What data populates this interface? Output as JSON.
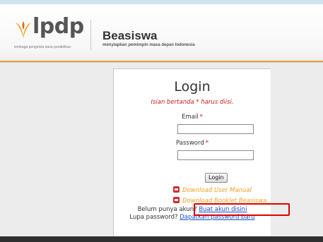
{
  "header": {
    "logo_text": "lpdp",
    "logo_tagline": "lembaga pengelola dana pendidikan",
    "brand_title": "Beasiswa",
    "brand_subtitle": "menyiapkan pemimpin masa depan Indonesia",
    "accent_color": "#e6a23a"
  },
  "login": {
    "title": "Login",
    "required_hint": "Isian bertanda * harus diisi.",
    "email_label": "Email",
    "password_label": "Password",
    "required_mark": "*",
    "email_value": "",
    "password_value": "",
    "submit_label": "Login"
  },
  "downloads": {
    "user_manual": "Download User Manual",
    "booklet": "Download Booklet Beasiswa"
  },
  "account": {
    "no_account_text": "Belum punya akun?",
    "create_account_link": "Buat akun disini",
    "forgot_text": "Lupa password?",
    "reset_link": "Dapatkan password baru"
  },
  "colors": {
    "required": "#cc2020",
    "link": "#1a4fc6",
    "download": "#f0a020",
    "highlight_box": "#e00000"
  }
}
